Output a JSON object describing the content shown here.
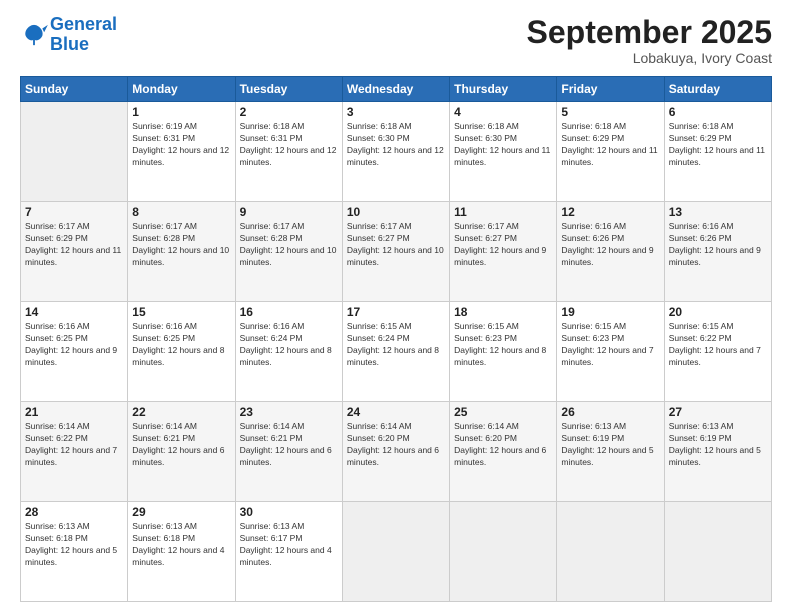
{
  "logo": {
    "line1": "General",
    "line2": "Blue"
  },
  "title": "September 2025",
  "location": "Lobakuya, Ivory Coast",
  "weekdays": [
    "Sunday",
    "Monday",
    "Tuesday",
    "Wednesday",
    "Thursday",
    "Friday",
    "Saturday"
  ],
  "weeks": [
    [
      {
        "day": "",
        "sunrise": "",
        "sunset": "",
        "daylight": ""
      },
      {
        "day": "1",
        "sunrise": "Sunrise: 6:19 AM",
        "sunset": "Sunset: 6:31 PM",
        "daylight": "Daylight: 12 hours and 12 minutes."
      },
      {
        "day": "2",
        "sunrise": "Sunrise: 6:18 AM",
        "sunset": "Sunset: 6:31 PM",
        "daylight": "Daylight: 12 hours and 12 minutes."
      },
      {
        "day": "3",
        "sunrise": "Sunrise: 6:18 AM",
        "sunset": "Sunset: 6:30 PM",
        "daylight": "Daylight: 12 hours and 12 minutes."
      },
      {
        "day": "4",
        "sunrise": "Sunrise: 6:18 AM",
        "sunset": "Sunset: 6:30 PM",
        "daylight": "Daylight: 12 hours and 11 minutes."
      },
      {
        "day": "5",
        "sunrise": "Sunrise: 6:18 AM",
        "sunset": "Sunset: 6:29 PM",
        "daylight": "Daylight: 12 hours and 11 minutes."
      },
      {
        "day": "6",
        "sunrise": "Sunrise: 6:18 AM",
        "sunset": "Sunset: 6:29 PM",
        "daylight": "Daylight: 12 hours and 11 minutes."
      }
    ],
    [
      {
        "day": "7",
        "sunrise": "Sunrise: 6:17 AM",
        "sunset": "Sunset: 6:29 PM",
        "daylight": "Daylight: 12 hours and 11 minutes."
      },
      {
        "day": "8",
        "sunrise": "Sunrise: 6:17 AM",
        "sunset": "Sunset: 6:28 PM",
        "daylight": "Daylight: 12 hours and 10 minutes."
      },
      {
        "day": "9",
        "sunrise": "Sunrise: 6:17 AM",
        "sunset": "Sunset: 6:28 PM",
        "daylight": "Daylight: 12 hours and 10 minutes."
      },
      {
        "day": "10",
        "sunrise": "Sunrise: 6:17 AM",
        "sunset": "Sunset: 6:27 PM",
        "daylight": "Daylight: 12 hours and 10 minutes."
      },
      {
        "day": "11",
        "sunrise": "Sunrise: 6:17 AM",
        "sunset": "Sunset: 6:27 PM",
        "daylight": "Daylight: 12 hours and 9 minutes."
      },
      {
        "day": "12",
        "sunrise": "Sunrise: 6:16 AM",
        "sunset": "Sunset: 6:26 PM",
        "daylight": "Daylight: 12 hours and 9 minutes."
      },
      {
        "day": "13",
        "sunrise": "Sunrise: 6:16 AM",
        "sunset": "Sunset: 6:26 PM",
        "daylight": "Daylight: 12 hours and 9 minutes."
      }
    ],
    [
      {
        "day": "14",
        "sunrise": "Sunrise: 6:16 AM",
        "sunset": "Sunset: 6:25 PM",
        "daylight": "Daylight: 12 hours and 9 minutes."
      },
      {
        "day": "15",
        "sunrise": "Sunrise: 6:16 AM",
        "sunset": "Sunset: 6:25 PM",
        "daylight": "Daylight: 12 hours and 8 minutes."
      },
      {
        "day": "16",
        "sunrise": "Sunrise: 6:16 AM",
        "sunset": "Sunset: 6:24 PM",
        "daylight": "Daylight: 12 hours and 8 minutes."
      },
      {
        "day": "17",
        "sunrise": "Sunrise: 6:15 AM",
        "sunset": "Sunset: 6:24 PM",
        "daylight": "Daylight: 12 hours and 8 minutes."
      },
      {
        "day": "18",
        "sunrise": "Sunrise: 6:15 AM",
        "sunset": "Sunset: 6:23 PM",
        "daylight": "Daylight: 12 hours and 8 minutes."
      },
      {
        "day": "19",
        "sunrise": "Sunrise: 6:15 AM",
        "sunset": "Sunset: 6:23 PM",
        "daylight": "Daylight: 12 hours and 7 minutes."
      },
      {
        "day": "20",
        "sunrise": "Sunrise: 6:15 AM",
        "sunset": "Sunset: 6:22 PM",
        "daylight": "Daylight: 12 hours and 7 minutes."
      }
    ],
    [
      {
        "day": "21",
        "sunrise": "Sunrise: 6:14 AM",
        "sunset": "Sunset: 6:22 PM",
        "daylight": "Daylight: 12 hours and 7 minutes."
      },
      {
        "day": "22",
        "sunrise": "Sunrise: 6:14 AM",
        "sunset": "Sunset: 6:21 PM",
        "daylight": "Daylight: 12 hours and 6 minutes."
      },
      {
        "day": "23",
        "sunrise": "Sunrise: 6:14 AM",
        "sunset": "Sunset: 6:21 PM",
        "daylight": "Daylight: 12 hours and 6 minutes."
      },
      {
        "day": "24",
        "sunrise": "Sunrise: 6:14 AM",
        "sunset": "Sunset: 6:20 PM",
        "daylight": "Daylight: 12 hours and 6 minutes."
      },
      {
        "day": "25",
        "sunrise": "Sunrise: 6:14 AM",
        "sunset": "Sunset: 6:20 PM",
        "daylight": "Daylight: 12 hours and 6 minutes."
      },
      {
        "day": "26",
        "sunrise": "Sunrise: 6:13 AM",
        "sunset": "Sunset: 6:19 PM",
        "daylight": "Daylight: 12 hours and 5 minutes."
      },
      {
        "day": "27",
        "sunrise": "Sunrise: 6:13 AM",
        "sunset": "Sunset: 6:19 PM",
        "daylight": "Daylight: 12 hours and 5 minutes."
      }
    ],
    [
      {
        "day": "28",
        "sunrise": "Sunrise: 6:13 AM",
        "sunset": "Sunset: 6:18 PM",
        "daylight": "Daylight: 12 hours and 5 minutes."
      },
      {
        "day": "29",
        "sunrise": "Sunrise: 6:13 AM",
        "sunset": "Sunset: 6:18 PM",
        "daylight": "Daylight: 12 hours and 4 minutes."
      },
      {
        "day": "30",
        "sunrise": "Sunrise: 6:13 AM",
        "sunset": "Sunset: 6:17 PM",
        "daylight": "Daylight: 12 hours and 4 minutes."
      },
      {
        "day": "",
        "sunrise": "",
        "sunset": "",
        "daylight": ""
      },
      {
        "day": "",
        "sunrise": "",
        "sunset": "",
        "daylight": ""
      },
      {
        "day": "",
        "sunrise": "",
        "sunset": "",
        "daylight": ""
      },
      {
        "day": "",
        "sunrise": "",
        "sunset": "",
        "daylight": ""
      }
    ]
  ]
}
